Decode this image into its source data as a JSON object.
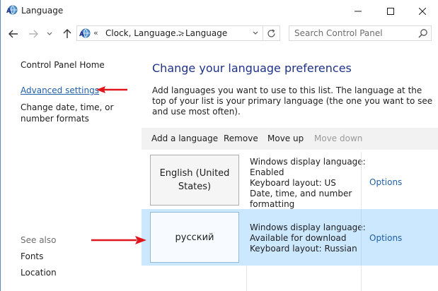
{
  "window": {
    "title": "Language",
    "icon": "language-globe-icon",
    "controls": [
      "minimize-icon",
      "maximize-icon",
      "close-icon"
    ]
  },
  "address_bar": {
    "overflow": "«",
    "crumbs": [
      "Clock, Language...",
      "Language"
    ],
    "separator": ">",
    "search_placeholder": "Search Control Panel"
  },
  "left_pane": {
    "home": "Control Panel Home",
    "advanced_settings": "Advanced settings",
    "change_date": "Change date, time, or number formats",
    "see_also": "See also",
    "fonts": "Fonts",
    "location": "Location"
  },
  "main": {
    "title": "Change your language preferences",
    "description": "Add languages you want to use to this list. The language at the top of your list is your primary language (the one you want to see and use most often).",
    "toolbar": {
      "add": "Add a language",
      "remove": "Remove",
      "move_up": "Move up",
      "move_down": "Move down"
    },
    "languages": [
      {
        "name": "English (United States)",
        "info": [
          "Windows display language:",
          "Enabled",
          "Keyboard layout: US",
          "Date, time, and number",
          "formatting"
        ],
        "options": "Options",
        "selected": false
      },
      {
        "name": "русский",
        "info": [
          "Windows display language:",
          "Available for download",
          "Keyboard layout: Russian"
        ],
        "options": "Options",
        "selected": true
      }
    ]
  },
  "colors": {
    "link": "#1f5fa8",
    "heading": "#1e3287",
    "selection": "#cce8ff",
    "annotation_arrow": "#e0161d"
  }
}
